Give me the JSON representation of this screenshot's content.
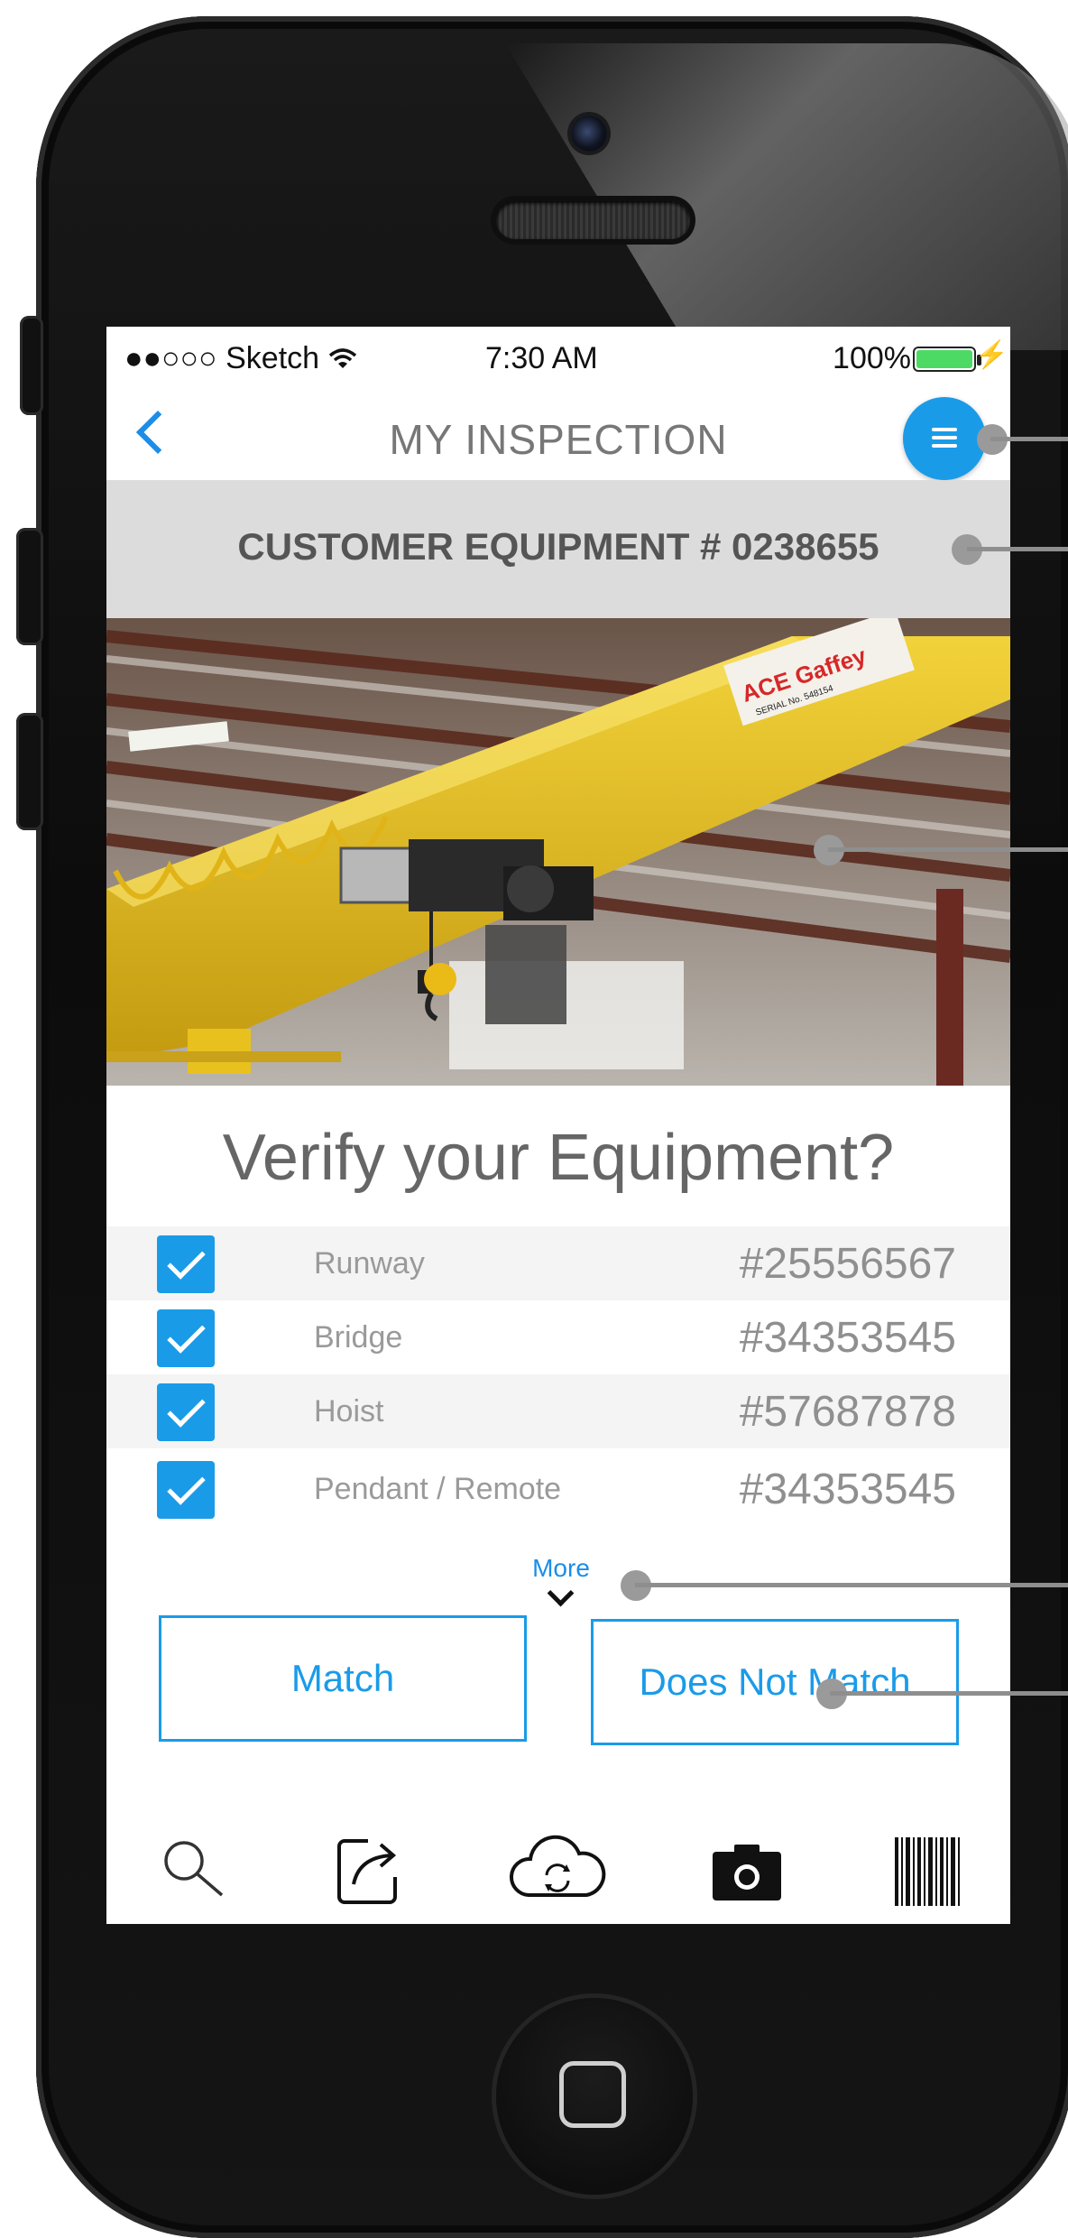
{
  "status_bar": {
    "carrier": "●●○○○ Sketch",
    "time": "7:30 AM",
    "battery": "100%"
  },
  "nav": {
    "title": "MY INSPECTION"
  },
  "equipment_header": "CUSTOMER EQUIPMENT # 0238655",
  "photo": {
    "sign_brand": "ACE Gaffey",
    "sign_serial": "SERIAL No. 548154"
  },
  "verify": {
    "title": "Verify your Equipment?",
    "items": [
      {
        "label": "Runway",
        "number": "#25556567",
        "checked": true
      },
      {
        "label": "Bridge",
        "number": "#34353545",
        "checked": true
      },
      {
        "label": "Hoist",
        "number": "#57687878",
        "checked": true
      },
      {
        "label": "Pendant / Remote",
        "number": "#34353545",
        "checked": true
      }
    ],
    "more_label": "More"
  },
  "actions": {
    "match": "Match",
    "no_match": "Does Not Match"
  },
  "tabbar": {
    "icons": [
      "search-icon",
      "share-icon",
      "cloud-sync-icon",
      "camera-icon",
      "barcode-icon"
    ]
  },
  "colors": {
    "accent": "#1a9be8",
    "header_bg": "#dcdcdc"
  }
}
